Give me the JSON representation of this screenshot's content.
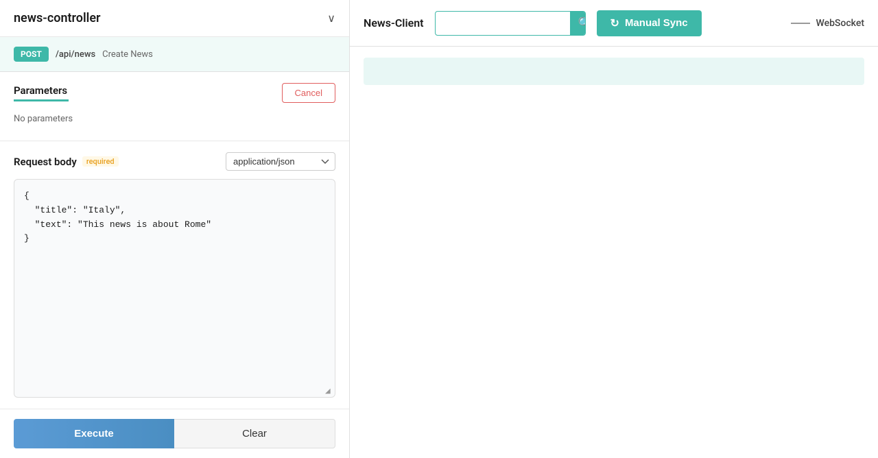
{
  "left": {
    "title": "news-controller",
    "chevron": "∨",
    "endpoint": {
      "method": "POST",
      "path": "/api/news",
      "label": "Create News"
    },
    "parameters": {
      "title": "Parameters",
      "no_params_text": "No parameters",
      "cancel_label": "Cancel"
    },
    "request_body": {
      "title": "Request body",
      "required_label": "required",
      "content_type": "application/json",
      "body_text": "{\n  \"title\": \"Italy\",\n  \"text\": \"This news is about Rome\"\n}"
    },
    "actions": {
      "execute_label": "Execute",
      "clear_label": "Clear"
    }
  },
  "right": {
    "client_label": "News-Client",
    "search": {
      "placeholder": "",
      "search_icon": "🔍"
    },
    "manual_sync": {
      "label": "Manual Sync",
      "icon": "↻"
    },
    "websocket": {
      "label": "WebSocket"
    }
  }
}
